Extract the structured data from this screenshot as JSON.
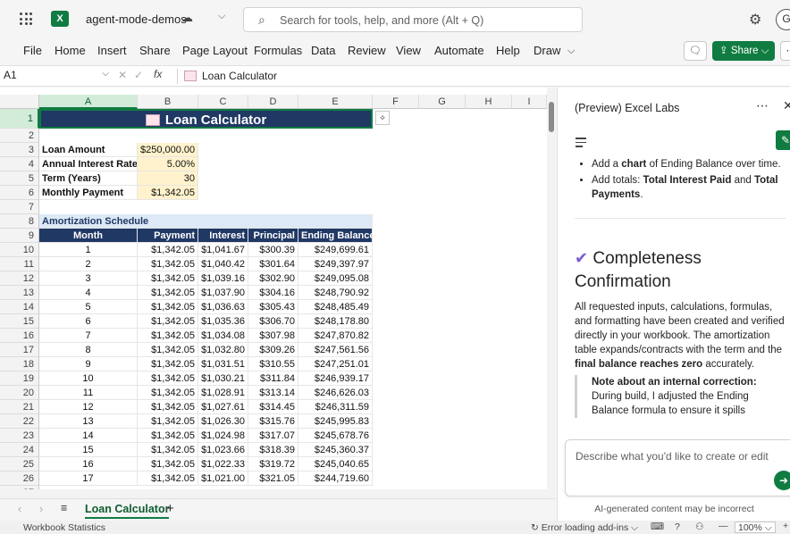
{
  "titlebar": {
    "doc_title": "agent-mode-demos",
    "search_placeholder": "Search for tools, help, and more (Alt + Q)",
    "avatar_initial": "G"
  },
  "menu": [
    "File",
    "Home",
    "Insert",
    "Share",
    "Page Layout",
    "Formulas",
    "Data",
    "Review",
    "View",
    "Automate",
    "Help",
    "Draw"
  ],
  "share_label": "Share",
  "formula_bar": {
    "cell_ref": "A1",
    "value": "Loan Calculator"
  },
  "columns": [
    "A",
    "B",
    "C",
    "D",
    "E",
    "F",
    "G",
    "H",
    "I"
  ],
  "sheet": {
    "title": "Loan Calculator",
    "inputs": [
      {
        "label": "Loan Amount",
        "value": "$250,000.00"
      },
      {
        "label": "Annual Interest Rate",
        "value": "5.00%"
      },
      {
        "label": "Term (Years)",
        "value": "30"
      },
      {
        "label": "Monthly Payment",
        "value": "$1,342.05"
      }
    ],
    "schedule_title": "Amortization Schedule",
    "headers": [
      "Month",
      "Payment",
      "Interest",
      "Principal",
      "Ending Balance"
    ],
    "rows": [
      [
        "1",
        "$1,342.05",
        "$1,041.67",
        "$300.39",
        "$249,699.61"
      ],
      [
        "2",
        "$1,342.05",
        "$1,040.42",
        "$301.64",
        "$249,397.97"
      ],
      [
        "3",
        "$1,342.05",
        "$1,039.16",
        "$302.90",
        "$249,095.08"
      ],
      [
        "4",
        "$1,342.05",
        "$1,037.90",
        "$304.16",
        "$248,790.92"
      ],
      [
        "5",
        "$1,342.05",
        "$1,036.63",
        "$305.43",
        "$248,485.49"
      ],
      [
        "6",
        "$1,342.05",
        "$1,035.36",
        "$306.70",
        "$248,178.80"
      ],
      [
        "7",
        "$1,342.05",
        "$1,034.08",
        "$307.98",
        "$247,870.82"
      ],
      [
        "8",
        "$1,342.05",
        "$1,032.80",
        "$309.26",
        "$247,561.56"
      ],
      [
        "9",
        "$1,342.05",
        "$1,031.51",
        "$310.55",
        "$247,251.01"
      ],
      [
        "10",
        "$1,342.05",
        "$1,030.21",
        "$311.84",
        "$246,939.17"
      ],
      [
        "11",
        "$1,342.05",
        "$1,028.91",
        "$313.14",
        "$246,626.03"
      ],
      [
        "12",
        "$1,342.05",
        "$1,027.61",
        "$314.45",
        "$246,311.59"
      ],
      [
        "13",
        "$1,342.05",
        "$1,026.30",
        "$315.76",
        "$245,995.83"
      ],
      [
        "14",
        "$1,342.05",
        "$1,024.98",
        "$317.07",
        "$245,678.76"
      ],
      [
        "15",
        "$1,342.05",
        "$1,023.66",
        "$318.39",
        "$245,360.37"
      ],
      [
        "16",
        "$1,342.05",
        "$1,022.33",
        "$319.72",
        "$245,040.65"
      ],
      [
        "17",
        "$1,342.05",
        "$1,021.00",
        "$321.05",
        "$244,719.60"
      ]
    ]
  },
  "tabs": {
    "active": "Loan Calculator"
  },
  "status": {
    "left": "Workbook Statistics",
    "addins": "Error loading add-ins",
    "zoom": "100%"
  },
  "pane": {
    "title": "(Preview) Excel Labs",
    "bullet1_pre": "Add a ",
    "bullet1_bold": "chart",
    "bullet1_post": " of Ending Balance over time.",
    "bullet2_pre": "Add totals: ",
    "bullet2_bold1": "Total Interest Paid",
    "bullet2_mid": " and ",
    "bullet2_bold2": "Total Payments",
    "bullet2_post": ".",
    "confirm_title": "Completeness Confirmation",
    "confirm_pre": "All requested inputs, calculations, formulas, and formatting have been created and verified directly in your workbook. The amortization table expands/contracts with the term and the ",
    "confirm_bold": "final balance reaches zero",
    "confirm_post": " accurately.",
    "note_title": "Note about an internal correction:",
    "note_body": "During build, I adjusted the Ending Balance formula to ensure it spills",
    "input_placeholder": "Describe what you'd like to create or edit",
    "disclaimer": "AI-generated content may be incorrect"
  },
  "colors": {
    "excel_green": "#107c41",
    "title_navy": "#1f3864",
    "header_navy": "#203864",
    "input_fill": "#fff2cc",
    "section_fill": "#dde9f6"
  }
}
